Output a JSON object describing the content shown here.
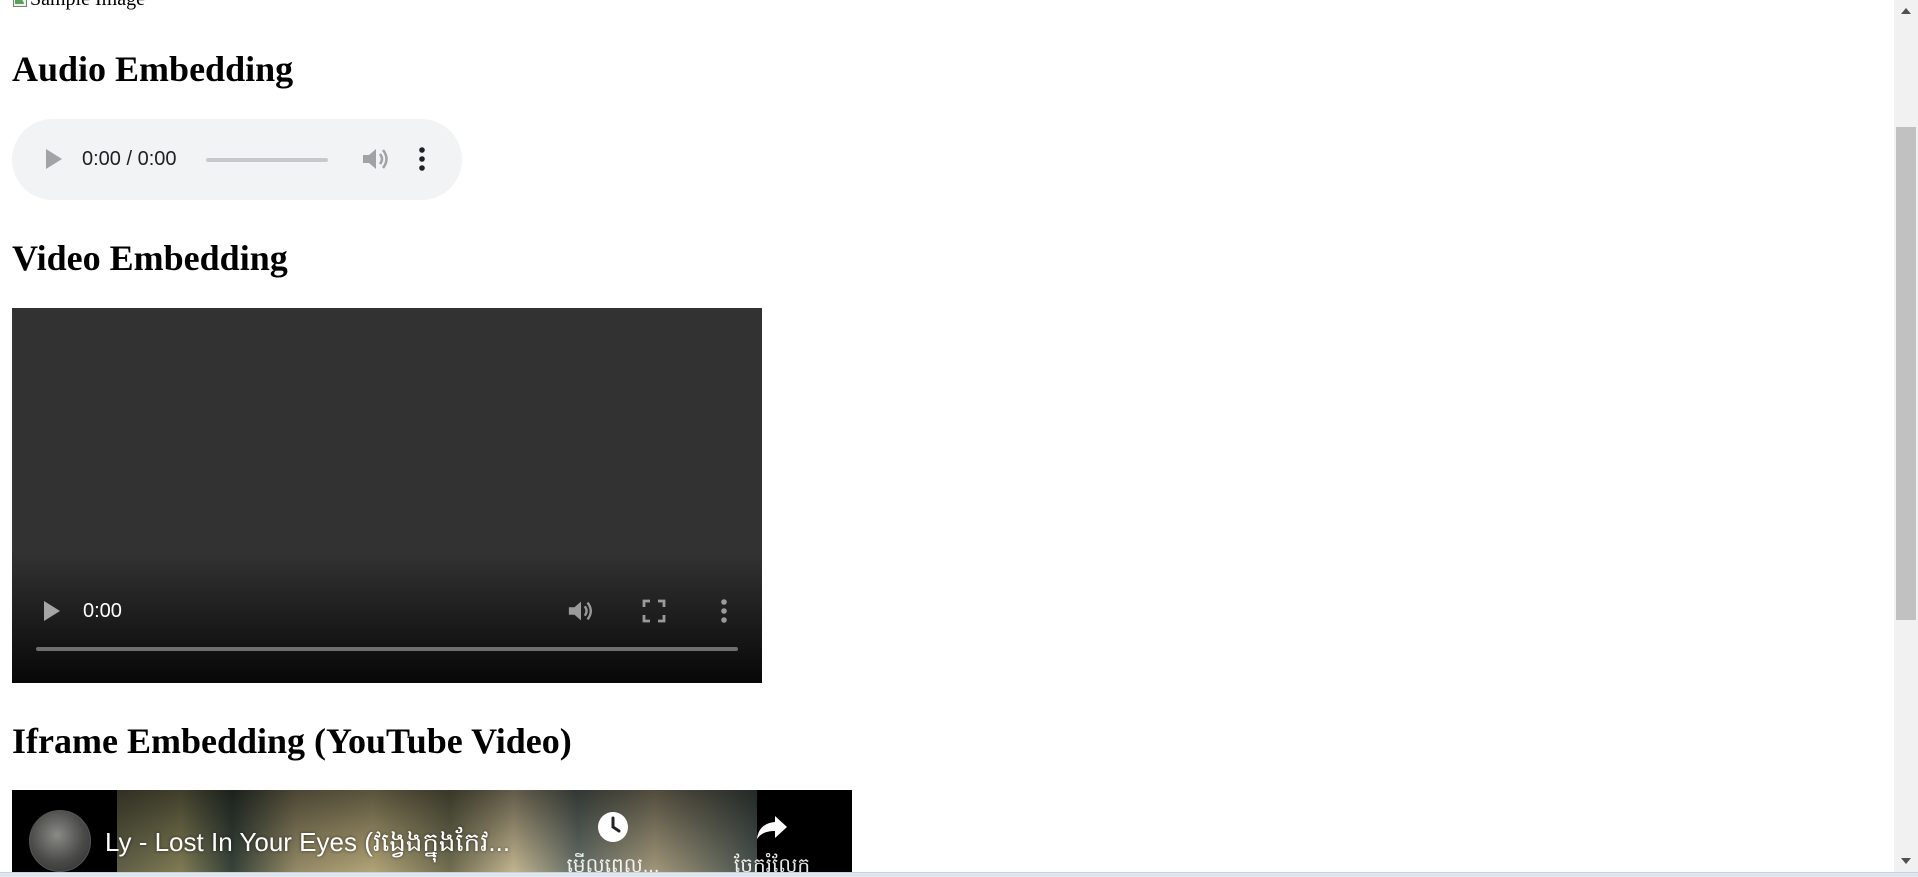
{
  "page": {
    "image_alt": "Sample Image",
    "headings": {
      "audio": "Audio Embedding",
      "video": "Video Embedding",
      "iframe": "Iframe Embedding (YouTube Video)"
    }
  },
  "audio_player": {
    "time": "0:00 / 0:00",
    "progress": 0
  },
  "video_player": {
    "time": "0:00",
    "progress": 0
  },
  "youtube_embed": {
    "title": "Ly - Lost In Your Eyes (វង្វេងក្នុងកែវ...",
    "watch_later_label": "មើលពេល...",
    "share_label": "ចែករំលែក"
  },
  "colors": {
    "audio_bg": "#f1f3f4",
    "video_bg": "#323232",
    "scroll_thumb": "#c1c1c1"
  }
}
